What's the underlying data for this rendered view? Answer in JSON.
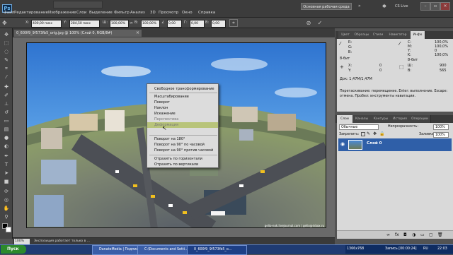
{
  "app": {
    "logo_text": "Ps"
  },
  "menu": [
    "Файл",
    "Редактирование",
    "Изображение",
    "Слои",
    "Выделение",
    "Фильтр",
    "Анализ",
    "3D",
    "Просмотр",
    "Окно",
    "Справка"
  ],
  "workspace_button": "Основная рабочая среда",
  "cs_live": "CS Live",
  "options": {
    "x_label": "X:",
    "x_value": "400,00 пикс",
    "y_label": "Y:",
    "y_value": "284,50 пикс",
    "w_label": "Ш:",
    "w_value": "100,00%",
    "h_label": "В:",
    "h_value": "100,00%",
    "angle_label": "∠",
    "angle_value": "0,00",
    "hskew_label": "Г:",
    "hskew_value": "0,00",
    "vskew_label": "В:",
    "vskew_value": "0,00"
  },
  "document": {
    "tab_label": "0_600f9_9f573fb5_orig.jpg @ 100% (Слой 0, RGB/8#)",
    "zoom": "100%",
    "status": "Экспозиция работает только в ...",
    "watermark": "gelio-nok.livejournal.com | gelio@inbox.ru"
  },
  "context_menu": {
    "items": [
      "Свободное трансформирование",
      "Масштабирование",
      "Поворот",
      "Наклон",
      "Искажение",
      "Перспектива",
      "Деформация",
      "Поворот на 180°",
      "Поворот на 90° по часовой",
      "Поворот на 90° против часовой",
      "Отразить по горизонтали",
      "Отразить по вертикали"
    ],
    "highlighted_index": 6
  },
  "panel_tabs_top": [
    "Цвет",
    "Образцы",
    "Стили",
    "Навигатор",
    "Инфо"
  ],
  "info": {
    "r_label": "R:",
    "g_label": "G:",
    "b_label": "B:",
    "bit_left": "8-бит",
    "c_label": "C:",
    "m_label": "M:",
    "yk_label": "Y:",
    "k_label": "K:",
    "c_val": "100,0%",
    "m_val": "100,0%",
    "y_val": "0",
    "k_val": "100,0%",
    "bit_right": "8-бит",
    "x_label": "X:",
    "x_val": "0",
    "y_label": "Y:",
    "w_label": "Ш:",
    "w_val": "900",
    "h_label": "В:",
    "h_val": "565",
    "doc_size": "Док: 1,47M/1,47M",
    "hint": "Перетаскивание: перемещение. Enter: выполнение. Escape: отмена. Пробел: инструменты навигации."
  },
  "panel_tabs_layers": [
    "Слои",
    "Каналы",
    "Контуры",
    "История",
    "Операции"
  ],
  "layers": {
    "blend_mode": "Обычные",
    "opacity_label": "Непрозрачность:",
    "opacity_value": "100%",
    "lock_label": "Закрепить:",
    "fill_label": "Заливка:",
    "fill_value": "100%",
    "layer_name": "Слой 0"
  },
  "taskbar": {
    "start": "Пуск",
    "tasks": [
      "DanateMedia | Подпищ...",
      "C:\\Documents and Setti...",
      "0_600f9_9f573fb5_o..."
    ],
    "resolution": "1366x768",
    "record": "Запись [00:00:24]",
    "lang": "RU",
    "clock": "22:03"
  },
  "colors": {
    "sky": "#4a8ad8",
    "menu_highlight": "#b8c47a",
    "layer_selected": "#2f5fa8"
  }
}
